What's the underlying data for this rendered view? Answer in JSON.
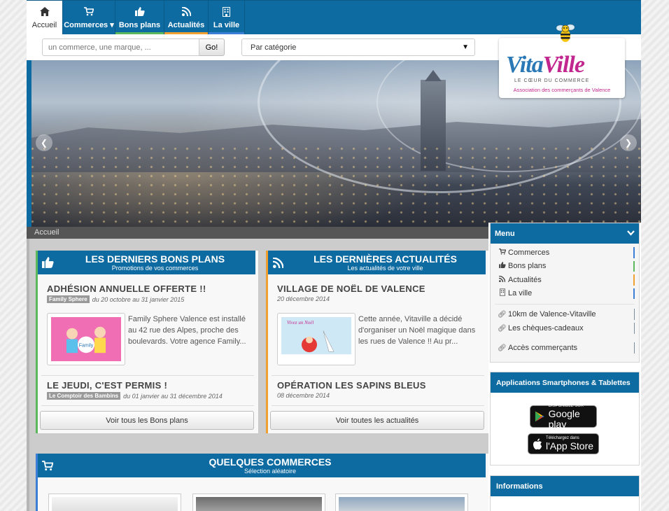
{
  "nav": {
    "items": [
      {
        "label": "Accueil",
        "icon": "home-icon"
      },
      {
        "label": "Commerces",
        "icon": "cart-icon",
        "caret": "▾"
      },
      {
        "label": "Bons plans",
        "icon": "thumbs-up-icon"
      },
      {
        "label": "Actualités",
        "icon": "rss-icon"
      },
      {
        "label": "La ville",
        "icon": "building-icon"
      }
    ],
    "colors": {
      "bons_plans": "#5cb85c",
      "actualites": "#f0a030",
      "ville": "#3a7fd5"
    }
  },
  "search": {
    "placeholder": "un commerce, une marque, ...",
    "button": "Go!"
  },
  "category_select": {
    "selected": "Par catégorie"
  },
  "logo": {
    "name_part1": "Vita",
    "name_part2": "Ville",
    "tagline": "LE CŒUR DU COMMERCE",
    "association": "Association des commerçants de Valence"
  },
  "breadcrumb": "Accueil",
  "bons_plans": {
    "title": "LES DERNIERS BONS PLANS",
    "subtitle": "Promotions de vos commerces",
    "items": [
      {
        "title": "ADHÉSION ANNUELLE OFFERTE !!",
        "shop": "Family Sphere",
        "dates": "du 20 octobre au 31 janvier 2015",
        "text": "Family Sphere Valence est installé au 42 rue des Alpes, proche des boulevards. Votre agence Family..."
      },
      {
        "title": "LE JEUDI, C'EST PERMIS !",
        "shop": "Le Comptoir des Bambins",
        "dates": "du 01 janvier au 31 décembre 2014"
      }
    ],
    "more": "Voir tous les Bons plans"
  },
  "actualites": {
    "title": "LES DERNIÈRES ACTUALITÉS",
    "subtitle": "Les actualités de votre ville",
    "items": [
      {
        "title": "VILLAGE DE NOËL DE VALENCE",
        "date": "20 décembre 2014",
        "text": "Cette année, Vitaville a décidé d'organiser un Noël magique dans les rues de Valence !! Au pr..."
      },
      {
        "title": "OPÉRATION LES SAPINS BLEUS",
        "date": "08 décembre 2014"
      }
    ],
    "more": "Voir toutes les actualités"
  },
  "commerces": {
    "title": "QUELQUES COMMERCES",
    "subtitle": "Sélection aléatoire"
  },
  "sidebar": {
    "menu_title": "Menu",
    "menu_items": [
      {
        "label": "Commerces",
        "icon": "cart-icon",
        "color": "#3a7fd5"
      },
      {
        "label": "Bons plans",
        "icon": "thumbs-up-icon",
        "color": "#5cb85c"
      },
      {
        "label": "Actualités",
        "icon": "rss-icon",
        "color": "#f0a030"
      },
      {
        "label": "La ville",
        "icon": "building-icon",
        "color": "#3a7fd5"
      }
    ],
    "links": [
      {
        "label": "10km de Valence-Vitaville"
      },
      {
        "label": "Les chèques-cadeaux"
      },
      {
        "label": "Accès commerçants"
      }
    ],
    "apps_title": "Applications Smartphones & Tablettes",
    "google": {
      "small": "DISPONIBLE SUR",
      "big": "Google play"
    },
    "apple": {
      "small": "Téléchargez dans",
      "big": "l'App Store"
    },
    "info_title": "Informations"
  }
}
